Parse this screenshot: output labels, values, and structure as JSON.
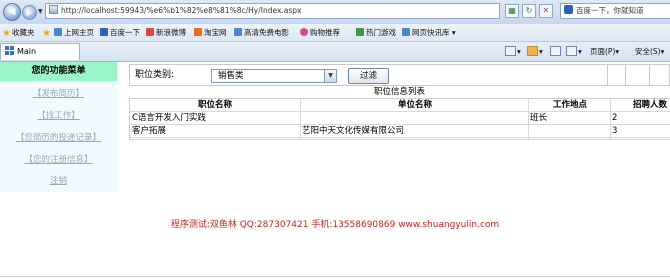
{
  "browser": {
    "url": "http://localhost:59943/%e6%b1%82%e8%81%8c/Hy/Index.aspx",
    "search_placeholder": "百度一下，你就知道",
    "tab_title": "Main"
  },
  "favorites": {
    "label": "收藏夹",
    "items": [
      "上网主页",
      "百度一下",
      "新浪微博",
      "淘宝网",
      "高清免费电影",
      "购物推荐",
      "热门游戏",
      "网页快讯库"
    ]
  },
  "command_bar": {
    "page": "页面(P)",
    "safety": "安全(S)"
  },
  "sidebar": {
    "title": "您的功能菜单",
    "items": [
      "【发布简历】",
      "【找工作】",
      "【您简历的投递记录】",
      "【您的注册信息】",
      "注销"
    ]
  },
  "filter": {
    "label": "职位类别:",
    "selected": "销售类",
    "button": "过滤"
  },
  "table": {
    "caption": "职位信息列表",
    "headers": [
      "职位名称",
      "单位名称",
      "工作地点",
      "招聘人数"
    ],
    "rows": [
      [
        "C语言开发入门实践",
        "",
        "班长",
        "2"
      ],
      [
        "客户拓展",
        "艺阳中天文化传媒有限公司",
        "",
        "3"
      ]
    ]
  },
  "footer": "程序测试:双鱼林 QQ:287307421 手机:13558690869 www.shuangyulin.com"
}
